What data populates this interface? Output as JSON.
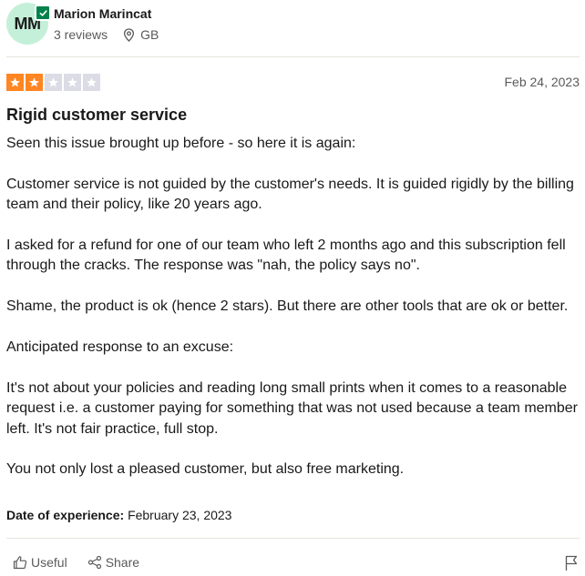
{
  "reviewer": {
    "initials": "MM",
    "name": "Marion Marincat",
    "reviews_count": "3 reviews",
    "country": "GB",
    "avatar_color": "#c4f0d9",
    "verified_color": "#04824b"
  },
  "review": {
    "rating": 2,
    "rating_max": 5,
    "star_color": "#ff8622",
    "date": "Feb 24, 2023",
    "title": "Rigid customer service",
    "paragraphs": [
      "Seen this issue brought up before - so here it is again:",
      "Customer service is not guided by the customer's needs. It is guided rigidly by the billing team and their policy, like 20 years ago.",
      "I asked for a refund for one of our team who left 2 months ago and this subscription fell through the cracks. The response was \"nah, the policy says no\".",
      "Shame, the product is ok (hence 2 stars). But there are other tools that are ok or better.",
      "Anticipated response to an excuse:",
      "It's not about your policies and reading long small prints when it comes to a reasonable request i.e. a customer paying for something that was not used because a team member left. It's not fair practice, full stop.",
      "You not only lost a pleased customer, but also free marketing."
    ],
    "experience_label": "Date of experience:",
    "experience_date": "February 23, 2023"
  },
  "actions": {
    "useful_label": "Useful",
    "share_label": "Share",
    "icons": [
      "thumbs-up-icon",
      "share-icon",
      "flag-icon"
    ]
  }
}
